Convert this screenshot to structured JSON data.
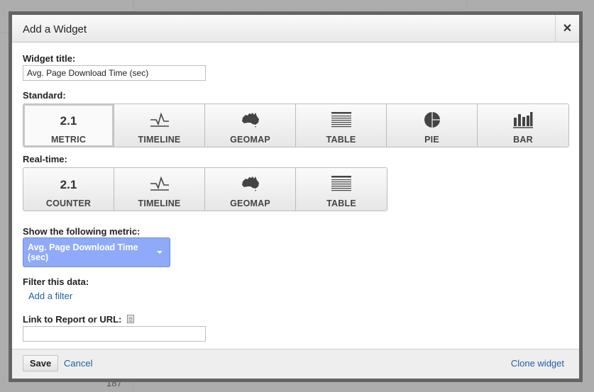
{
  "background": {
    "partial_number": "187"
  },
  "dialog": {
    "title": "Add a Widget",
    "close_icon": "close-icon",
    "widget_title": {
      "label": "Widget title:",
      "value": "Avg. Page Download Time (sec)"
    },
    "standard": {
      "label": "Standard:",
      "buttons": [
        {
          "id": "metric",
          "icon": "2.1",
          "icon_type": "number",
          "label": "METRIC",
          "selected": true
        },
        {
          "id": "timeline",
          "icon": "timeline-icon",
          "icon_type": "timeline",
          "label": "TIMELINE",
          "selected": false
        },
        {
          "id": "geomap",
          "icon": "australia-map-icon",
          "icon_type": "geomap",
          "label": "GEOMAP",
          "selected": false
        },
        {
          "id": "table",
          "icon": "table-icon",
          "icon_type": "table",
          "label": "TABLE",
          "selected": false
        },
        {
          "id": "pie",
          "icon": "pie-chart-icon",
          "icon_type": "pie",
          "label": "PIE",
          "selected": false
        },
        {
          "id": "bar",
          "icon": "bar-chart-icon",
          "icon_type": "bar",
          "label": "BAR",
          "selected": false
        }
      ]
    },
    "realtime": {
      "label": "Real-time:",
      "buttons": [
        {
          "id": "counter",
          "icon": "2.1",
          "icon_type": "number",
          "label": "COUNTER",
          "selected": false
        },
        {
          "id": "timeline",
          "icon": "timeline-icon",
          "icon_type": "timeline",
          "label": "TIMELINE",
          "selected": false
        },
        {
          "id": "geomap",
          "icon": "australia-map-icon",
          "icon_type": "geomap",
          "label": "GEOMAP",
          "selected": false
        },
        {
          "id": "table",
          "icon": "table-icon",
          "icon_type": "table",
          "label": "TABLE",
          "selected": false
        }
      ]
    },
    "metric": {
      "label": "Show the following metric:",
      "selected": "Avg. Page Download Time (sec)"
    },
    "filter": {
      "label": "Filter this data:",
      "add_link": "Add a filter"
    },
    "link_report": {
      "label": "Link to Report or URL:",
      "value": "",
      "placeholder": ""
    },
    "footer": {
      "save": "Save",
      "cancel": "Cancel",
      "clone": "Clone widget"
    },
    "colors": {
      "metric_select_bg": "#8faaf8",
      "link": "#1f5fa6",
      "overlay": "#adadad",
      "dialog_border": "#646464"
    }
  }
}
